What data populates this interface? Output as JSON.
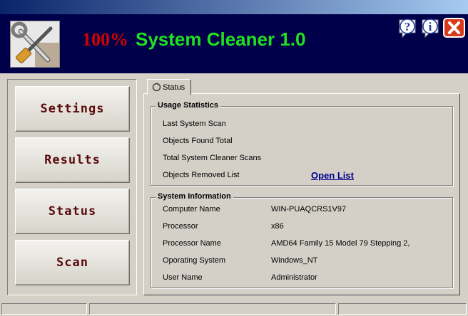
{
  "header": {
    "title_percent": "100%",
    "title_name": "System Cleaner 1.0",
    "help_icon": "question-mark-icon",
    "info_icon": "info-icon",
    "close_icon": "close-x-icon"
  },
  "nav": {
    "settings": "Settings",
    "results": "Results",
    "status": "Status",
    "scan": "Scan"
  },
  "tab": {
    "label": "Status"
  },
  "usage": {
    "title": "Usage Statistics",
    "rows": [
      "Last System Scan",
      "Objects Found Total",
      "Total System Cleaner Scans",
      "Objects Removed List"
    ],
    "open_list": "Open List"
  },
  "sysinfo": {
    "title": "System Information",
    "rows": [
      {
        "label": "Computer Name",
        "value": "WIN-PUAQCRS1V97"
      },
      {
        "label": "Processor",
        "value": "x86"
      },
      {
        "label": "Processor Name",
        "value": "AMD64 Family 15 Model 79 Stepping 2,"
      },
      {
        "label": "Oporating System",
        "value": "Windows_NT"
      },
      {
        "label": "User Name",
        "value": "Administrator"
      }
    ]
  },
  "colors": {
    "header_bg": "#00004a",
    "title_red": "#d00000",
    "title_green": "#21e021",
    "nav_text": "#5a0a0a",
    "link": "#00008b"
  }
}
